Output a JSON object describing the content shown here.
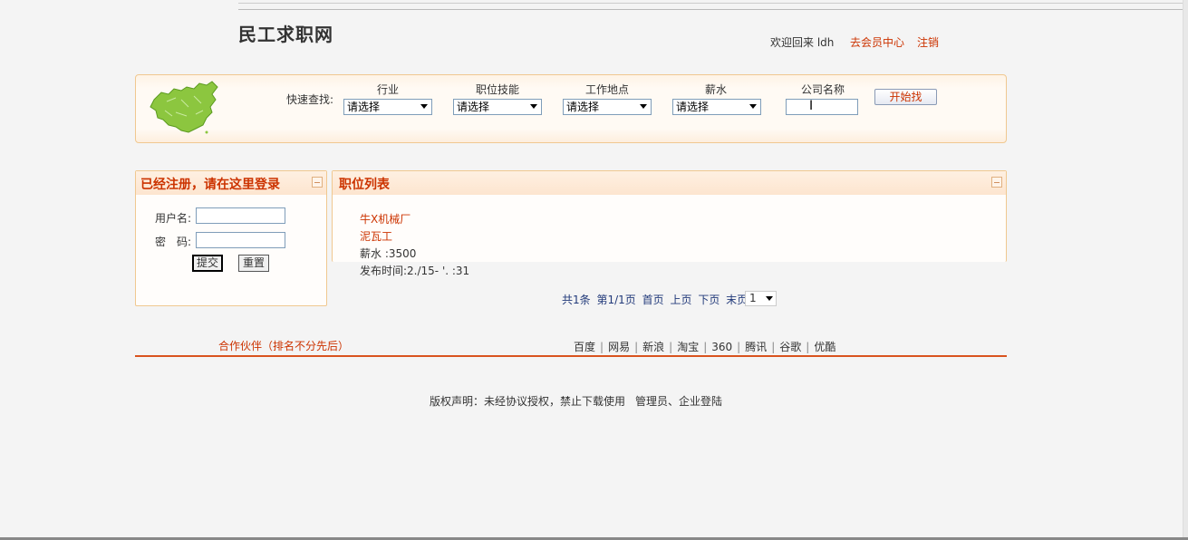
{
  "header": {
    "site_title": "民工求职网",
    "welcome": "欢迎回来 ldh",
    "member_center": "去会员中心",
    "logout": "注销"
  },
  "search": {
    "quick_label": "快速查找:",
    "filters": [
      {
        "label": "行业",
        "value": "请选择"
      },
      {
        "label": "职位技能",
        "value": "请选择"
      },
      {
        "label": "工作地点",
        "value": "请选择"
      },
      {
        "label": "薪水",
        "value": "请选择"
      }
    ],
    "company_label": "公司名称",
    "company_value": "",
    "search_button": "开始找"
  },
  "login": {
    "title": "已经注册，请在这里登录",
    "username_label": "用户名:",
    "password_label": "密　码:",
    "submit": "提交",
    "reset": "重置"
  },
  "jobs": {
    "title": "职位列表",
    "items": [
      {
        "company": "牛X机械厂",
        "title": "泥瓦工",
        "salary": "薪水 :3500",
        "time": "发布时间:2./15- '. :31"
      }
    ]
  },
  "pager": {
    "total": "共1条",
    "current": "第1/1页",
    "first": "首页",
    "prev": "上页",
    "next": "下页",
    "last": "末页",
    "page_value": "1"
  },
  "partners": {
    "title": "合作伙伴（排名不分先后）",
    "items": [
      "百度",
      "网易",
      "新浪",
      "淘宝",
      "360",
      "腾讯",
      "谷歌",
      "优酷"
    ]
  },
  "footer": {
    "copyright": "版权声明：未经协议授权，禁止下载使用",
    "admin_link": "管理员、企业登陆"
  },
  "colors": {
    "accent": "#cc3300",
    "border": "#f0c890",
    "link_blue": "#223a7a"
  }
}
